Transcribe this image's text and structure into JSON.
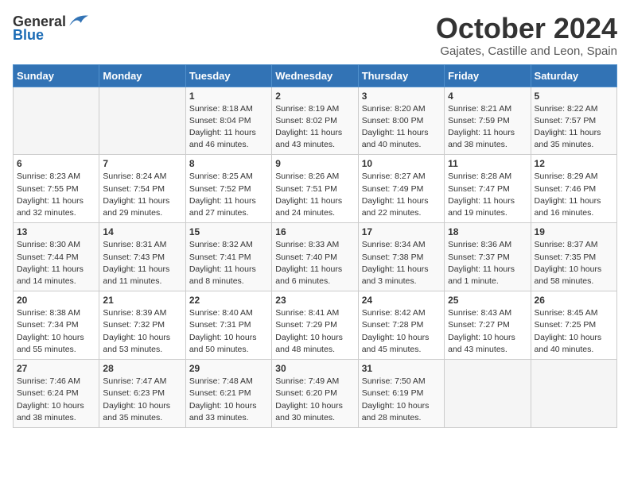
{
  "header": {
    "logo_general": "General",
    "logo_blue": "Blue",
    "month": "October 2024",
    "location": "Gajates, Castille and Leon, Spain"
  },
  "weekdays": [
    "Sunday",
    "Monday",
    "Tuesday",
    "Wednesday",
    "Thursday",
    "Friday",
    "Saturday"
  ],
  "weeks": [
    [
      {
        "day": "",
        "text": ""
      },
      {
        "day": "",
        "text": ""
      },
      {
        "day": "1",
        "text": "Sunrise: 8:18 AM\nSunset: 8:04 PM\nDaylight: 11 hours and 46 minutes."
      },
      {
        "day": "2",
        "text": "Sunrise: 8:19 AM\nSunset: 8:02 PM\nDaylight: 11 hours and 43 minutes."
      },
      {
        "day": "3",
        "text": "Sunrise: 8:20 AM\nSunset: 8:00 PM\nDaylight: 11 hours and 40 minutes."
      },
      {
        "day": "4",
        "text": "Sunrise: 8:21 AM\nSunset: 7:59 PM\nDaylight: 11 hours and 38 minutes."
      },
      {
        "day": "5",
        "text": "Sunrise: 8:22 AM\nSunset: 7:57 PM\nDaylight: 11 hours and 35 minutes."
      }
    ],
    [
      {
        "day": "6",
        "text": "Sunrise: 8:23 AM\nSunset: 7:55 PM\nDaylight: 11 hours and 32 minutes."
      },
      {
        "day": "7",
        "text": "Sunrise: 8:24 AM\nSunset: 7:54 PM\nDaylight: 11 hours and 29 minutes."
      },
      {
        "day": "8",
        "text": "Sunrise: 8:25 AM\nSunset: 7:52 PM\nDaylight: 11 hours and 27 minutes."
      },
      {
        "day": "9",
        "text": "Sunrise: 8:26 AM\nSunset: 7:51 PM\nDaylight: 11 hours and 24 minutes."
      },
      {
        "day": "10",
        "text": "Sunrise: 8:27 AM\nSunset: 7:49 PM\nDaylight: 11 hours and 22 minutes."
      },
      {
        "day": "11",
        "text": "Sunrise: 8:28 AM\nSunset: 7:47 PM\nDaylight: 11 hours and 19 minutes."
      },
      {
        "day": "12",
        "text": "Sunrise: 8:29 AM\nSunset: 7:46 PM\nDaylight: 11 hours and 16 minutes."
      }
    ],
    [
      {
        "day": "13",
        "text": "Sunrise: 8:30 AM\nSunset: 7:44 PM\nDaylight: 11 hours and 14 minutes."
      },
      {
        "day": "14",
        "text": "Sunrise: 8:31 AM\nSunset: 7:43 PM\nDaylight: 11 hours and 11 minutes."
      },
      {
        "day": "15",
        "text": "Sunrise: 8:32 AM\nSunset: 7:41 PM\nDaylight: 11 hours and 8 minutes."
      },
      {
        "day": "16",
        "text": "Sunrise: 8:33 AM\nSunset: 7:40 PM\nDaylight: 11 hours and 6 minutes."
      },
      {
        "day": "17",
        "text": "Sunrise: 8:34 AM\nSunset: 7:38 PM\nDaylight: 11 hours and 3 minutes."
      },
      {
        "day": "18",
        "text": "Sunrise: 8:36 AM\nSunset: 7:37 PM\nDaylight: 11 hours and 1 minute."
      },
      {
        "day": "19",
        "text": "Sunrise: 8:37 AM\nSunset: 7:35 PM\nDaylight: 10 hours and 58 minutes."
      }
    ],
    [
      {
        "day": "20",
        "text": "Sunrise: 8:38 AM\nSunset: 7:34 PM\nDaylight: 10 hours and 55 minutes."
      },
      {
        "day": "21",
        "text": "Sunrise: 8:39 AM\nSunset: 7:32 PM\nDaylight: 10 hours and 53 minutes."
      },
      {
        "day": "22",
        "text": "Sunrise: 8:40 AM\nSunset: 7:31 PM\nDaylight: 10 hours and 50 minutes."
      },
      {
        "day": "23",
        "text": "Sunrise: 8:41 AM\nSunset: 7:29 PM\nDaylight: 10 hours and 48 minutes."
      },
      {
        "day": "24",
        "text": "Sunrise: 8:42 AM\nSunset: 7:28 PM\nDaylight: 10 hours and 45 minutes."
      },
      {
        "day": "25",
        "text": "Sunrise: 8:43 AM\nSunset: 7:27 PM\nDaylight: 10 hours and 43 minutes."
      },
      {
        "day": "26",
        "text": "Sunrise: 8:45 AM\nSunset: 7:25 PM\nDaylight: 10 hours and 40 minutes."
      }
    ],
    [
      {
        "day": "27",
        "text": "Sunrise: 7:46 AM\nSunset: 6:24 PM\nDaylight: 10 hours and 38 minutes."
      },
      {
        "day": "28",
        "text": "Sunrise: 7:47 AM\nSunset: 6:23 PM\nDaylight: 10 hours and 35 minutes."
      },
      {
        "day": "29",
        "text": "Sunrise: 7:48 AM\nSunset: 6:21 PM\nDaylight: 10 hours and 33 minutes."
      },
      {
        "day": "30",
        "text": "Sunrise: 7:49 AM\nSunset: 6:20 PM\nDaylight: 10 hours and 30 minutes."
      },
      {
        "day": "31",
        "text": "Sunrise: 7:50 AM\nSunset: 6:19 PM\nDaylight: 10 hours and 28 minutes."
      },
      {
        "day": "",
        "text": ""
      },
      {
        "day": "",
        "text": ""
      }
    ]
  ]
}
